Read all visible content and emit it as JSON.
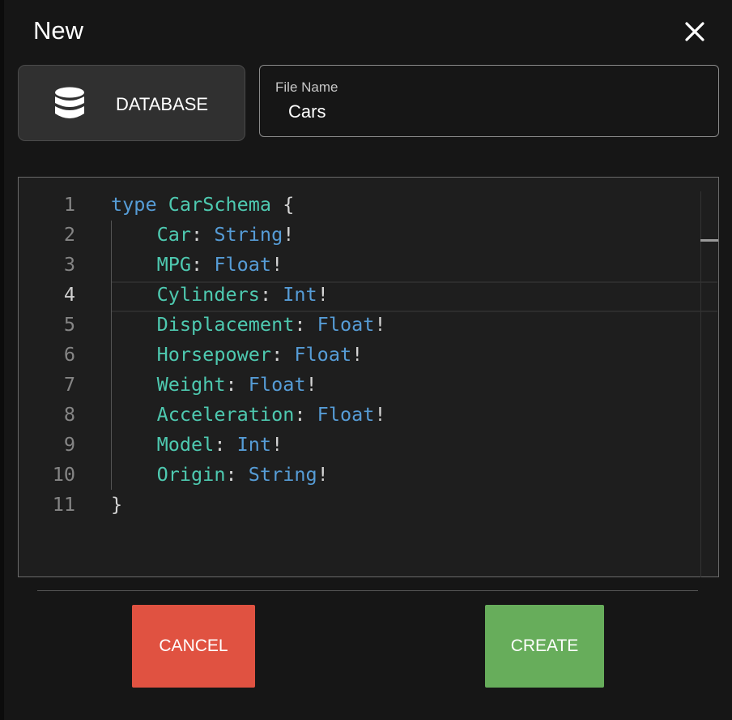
{
  "dialog": {
    "title": "New",
    "close_icon": "close-icon"
  },
  "type_button": {
    "label": "DATABASE",
    "icon": "database-icon"
  },
  "file_name": {
    "label": "File Name",
    "value": "Cars"
  },
  "editor": {
    "active_line": 4,
    "lines": [
      {
        "n": "1",
        "tokens": [
          [
            "kw",
            "type "
          ],
          [
            "ty",
            "CarSchema"
          ],
          [
            "p",
            " {"
          ]
        ]
      },
      {
        "n": "2",
        "tokens": [
          [
            "p",
            "    "
          ],
          [
            "fn",
            "Car"
          ],
          [
            "p",
            ": "
          ],
          [
            "tp",
            "String"
          ],
          [
            "p",
            "!"
          ]
        ]
      },
      {
        "n": "3",
        "tokens": [
          [
            "p",
            "    "
          ],
          [
            "fn",
            "MPG"
          ],
          [
            "p",
            ": "
          ],
          [
            "tp",
            "Float"
          ],
          [
            "p",
            "!"
          ]
        ]
      },
      {
        "n": "4",
        "tokens": [
          [
            "p",
            "    "
          ],
          [
            "fn",
            "Cylinders"
          ],
          [
            "p",
            ": "
          ],
          [
            "tp",
            "Int"
          ],
          [
            "p",
            "!"
          ]
        ]
      },
      {
        "n": "5",
        "tokens": [
          [
            "p",
            "    "
          ],
          [
            "fn",
            "Displacement"
          ],
          [
            "p",
            ": "
          ],
          [
            "tp",
            "Float"
          ],
          [
            "p",
            "!"
          ]
        ]
      },
      {
        "n": "6",
        "tokens": [
          [
            "p",
            "    "
          ],
          [
            "fn",
            "Horsepower"
          ],
          [
            "p",
            ": "
          ],
          [
            "tp",
            "Float"
          ],
          [
            "p",
            "!"
          ]
        ]
      },
      {
        "n": "7",
        "tokens": [
          [
            "p",
            "    "
          ],
          [
            "fn",
            "Weight"
          ],
          [
            "p",
            ": "
          ],
          [
            "tp",
            "Float"
          ],
          [
            "p",
            "!"
          ]
        ]
      },
      {
        "n": "8",
        "tokens": [
          [
            "p",
            "    "
          ],
          [
            "fn",
            "Acceleration"
          ],
          [
            "p",
            ": "
          ],
          [
            "tp",
            "Float"
          ],
          [
            "p",
            "!"
          ]
        ]
      },
      {
        "n": "9",
        "tokens": [
          [
            "p",
            "    "
          ],
          [
            "fn",
            "Model"
          ],
          [
            "p",
            ": "
          ],
          [
            "tp",
            "Int"
          ],
          [
            "p",
            "!"
          ]
        ]
      },
      {
        "n": "10",
        "tokens": [
          [
            "p",
            "    "
          ],
          [
            "fn",
            "Origin"
          ],
          [
            "p",
            ": "
          ],
          [
            "tp",
            "String"
          ],
          [
            "p",
            "!"
          ]
        ]
      },
      {
        "n": "11",
        "tokens": [
          [
            "p",
            "}"
          ]
        ]
      }
    ]
  },
  "actions": {
    "cancel": "CANCEL",
    "create": "CREATE"
  },
  "colors": {
    "cancel": "#e05241",
    "create": "#67ad5b",
    "keyword": "#569cd6",
    "identifier": "#4ec9b0"
  }
}
